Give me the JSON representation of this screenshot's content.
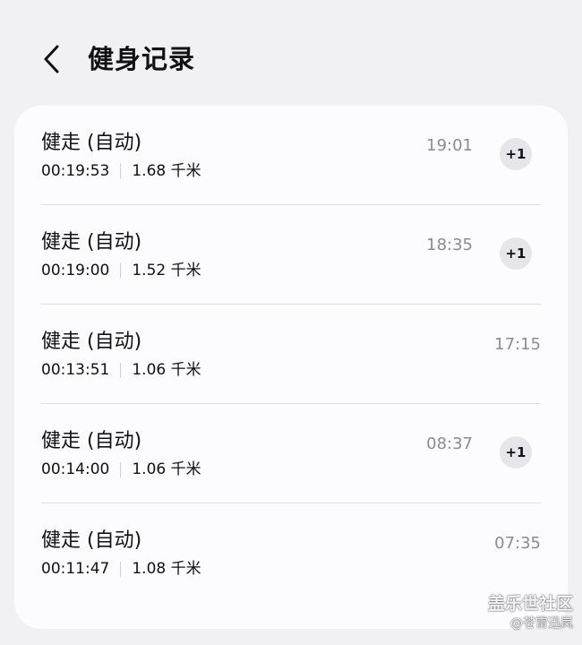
{
  "header": {
    "title": "健身记录",
    "back_icon": "chevron-left-icon"
  },
  "records": [
    {
      "name": "健走 (自动)",
      "duration": "00:19:53",
      "distance": "1.68 千米",
      "time": "19:01",
      "badge": "+1"
    },
    {
      "name": "健走 (自动)",
      "duration": "00:19:00",
      "distance": "1.52 千米",
      "time": "18:35",
      "badge": "+1"
    },
    {
      "name": "健走 (自动)",
      "duration": "00:13:51",
      "distance": "1.06 千米",
      "time": "17:15",
      "badge": null
    },
    {
      "name": "健走 (自动)",
      "duration": "00:14:00",
      "distance": "1.06 千米",
      "time": "08:37",
      "badge": "+1"
    },
    {
      "name": "健走 (自动)",
      "duration": "00:11:47",
      "distance": "1.08 千米",
      "time": "07:35",
      "badge": null
    }
  ],
  "watermark": {
    "brand": "盖乐世社区",
    "user": "@苍雷迅岚"
  },
  "colors": {
    "background": "#f1f1f4",
    "card": "#fcfcfe",
    "time_text": "#8a8a90",
    "badge_bg": "#e6e6ea",
    "divider": "#dedee2"
  }
}
